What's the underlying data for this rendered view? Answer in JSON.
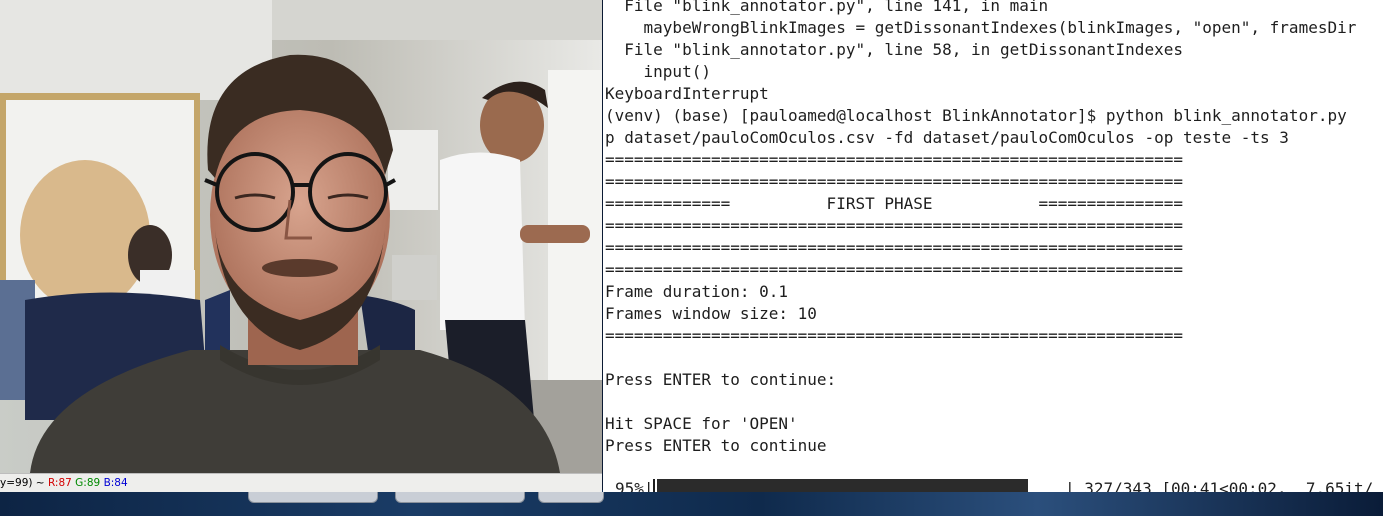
{
  "viewer": {
    "status_prefix": "y=99) ~ ",
    "r_value": "R:87",
    "g_value": "G:89",
    "b_value": "B:84"
  },
  "terminal": {
    "lines": [
      "  File \"blink_annotator.py\", line 141, in main",
      "    maybeWrongBlinkImages = getDissonantIndexes(blinkImages, \"open\", framesDir",
      "  File \"blink_annotator.py\", line 58, in getDissonantIndexes",
      "    input()",
      "KeyboardInterrupt",
      "(venv) (base) [pauloamed@localhost BlinkAnnotator]$ python blink_annotator.py",
      "p dataset/pauloComOculos.csv -fd dataset/pauloComOculos -op teste -ts 3",
      "============================================================",
      "============================================================",
      "=============          FIRST PHASE           ===============",
      "============================================================",
      "============================================================",
      "============================================================",
      "Frame duration: 0.1",
      "Frames window size: 10",
      "============================================================",
      "",
      "Press ENTER to continue:",
      "",
      "Hit SPACE for 'OPEN'",
      "Press ENTER to continue"
    ],
    "progress": {
      "percent_label": "95%|",
      "fraction": 0.95,
      "stats": "| 327/343 [00:41<00:02,  7.65it/"
    }
  },
  "colors": {
    "status_red": "#d40000",
    "status_green": "#008a00",
    "status_blue": "#0000d4"
  }
}
